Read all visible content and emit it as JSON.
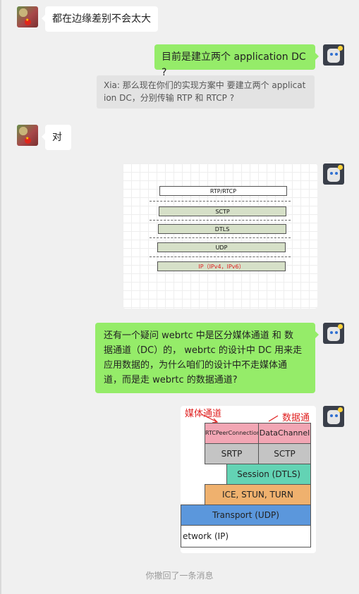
{
  "messages": {
    "m1": {
      "text": "都在边缘差别不会太大"
    },
    "m2": {
      "text": "目前是建立两个 application DC ?"
    },
    "quote": {
      "line1": "Xia: 那么现在你们的实现方案中  要建立两个 applicat",
      "line2": "ion DC，分别传输 RTP 和 RTCP ?"
    },
    "m3": {
      "text": "对"
    },
    "m5": {
      "line1": "还有一个疑问   webrtc 中是区分媒体通道 和 数",
      "line2": "据通道（DC）的， webrtc 的设计中 DC 用来走",
      "line3": "应用数据的，为什么咱们的设计中不走媒体通",
      "line4": "道，而是走 webrtc 的数据通道?"
    },
    "system": "你撤回了一条消息"
  },
  "stack_diagram": {
    "layers": [
      "RTP/RTCP",
      "SCTP",
      "DTLS",
      "UDP",
      "IP（IPv4，IPv6）"
    ],
    "colors": {
      "fill": "#d6e0c8",
      "ip_text": "#e02020"
    }
  },
  "webrtc_diagram": {
    "annotation_media": "媒体通道",
    "annotation_data": "数据通道",
    "cells": {
      "rtc": "RTCPeerConnection",
      "dc": "DataChannel",
      "srtp": "SRTP",
      "sctp": "SCTP",
      "session": "Session (DTLS)",
      "ice": "ICE, STUN, TURN",
      "transport": "Transport (UDP)",
      "network": "etwork (IP)"
    },
    "colors": {
      "pink": "#f2a6b4",
      "gray": "#c4c4c4",
      "teal": "#63d3b4",
      "orange": "#efb16e",
      "blue": "#5b97dc",
      "white": "#ffffff"
    }
  },
  "theme": {
    "chat_bg": "#f0f0f0",
    "green_bubble": "#95ec69",
    "white_bubble": "#ffffff"
  }
}
